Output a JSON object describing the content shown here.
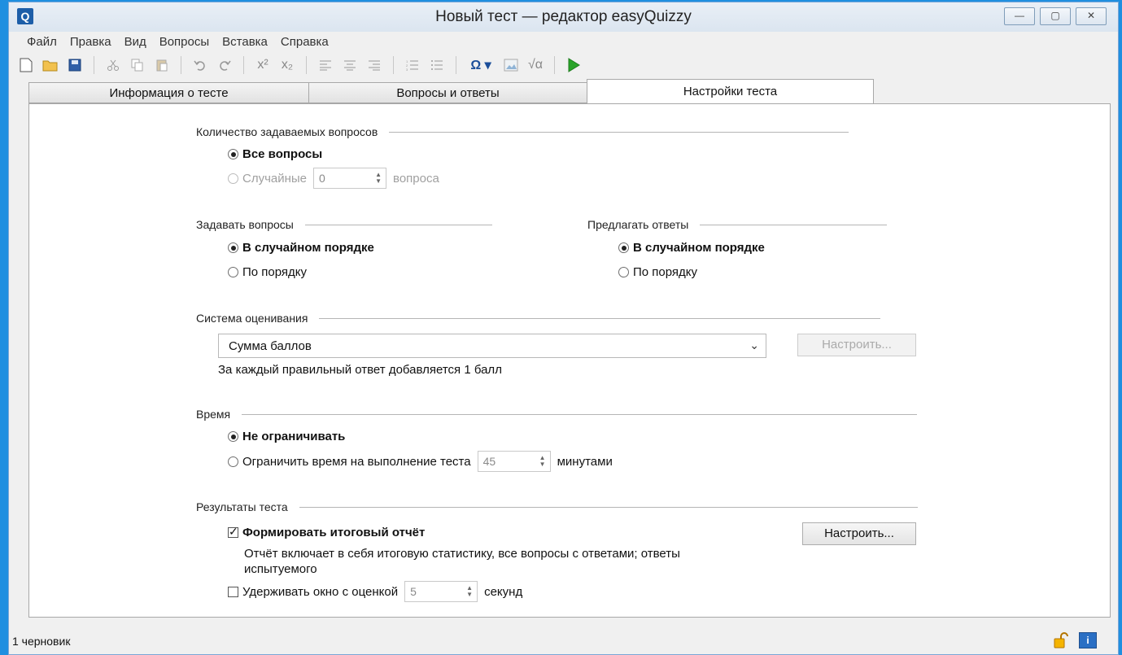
{
  "window": {
    "title": "Новый тест — редактор easyQuizzy",
    "app_icon_letter": "Q",
    "controls": [
      "—",
      "▢",
      "✕"
    ]
  },
  "menu": [
    "Файл",
    "Правка",
    "Вид",
    "Вопросы",
    "Вставка",
    "Справка"
  ],
  "toolbar": {
    "icons": [
      "new-document-icon",
      "open-folder-icon",
      "save-icon",
      "sep",
      "cut-icon",
      "copy-icon",
      "paste-icon",
      "sep",
      "undo-icon",
      "redo-icon",
      "sep",
      "superscript-icon",
      "subscript-icon",
      "sep",
      "align-left-icon",
      "align-center-icon",
      "align-right-icon",
      "sep",
      "numbered-list-icon",
      "bullet-list-icon",
      "sep",
      "symbol-omega-icon",
      "image-icon",
      "formula-icon",
      "sep",
      "run-test-icon"
    ],
    "superscript_label": "x²",
    "subscript_label": "x₂",
    "omega_label": "Ω ▾",
    "formula_label": "√α"
  },
  "tabs": [
    {
      "label": "Информация о тесте",
      "active": false
    },
    {
      "label": "Вопросы и ответы",
      "active": false
    },
    {
      "label": "Настройки теста",
      "active": true
    }
  ],
  "questions_count": {
    "title": "Количество задаваемых вопросов",
    "all_label": "Все вопросы",
    "random_label": "Случайные",
    "random_value": "0",
    "random_unit": "вопроса"
  },
  "ask_questions": {
    "title": "Задавать вопросы",
    "random_label": "В случайном порядке",
    "ordered_label": "По порядку"
  },
  "offer_answers": {
    "title": "Предлагать ответы",
    "random_label": "В случайном порядке",
    "ordered_label": "По порядку"
  },
  "grading": {
    "title": "Система оценивания",
    "selected": "Сумма баллов",
    "configure_label": "Настроить...",
    "description": "За каждый правильный ответ добавляется 1 балл"
  },
  "time": {
    "title": "Время",
    "unlimited_label": "Не ограничивать",
    "limit_label": "Ограничить время на выполнение теста",
    "limit_value": "45",
    "limit_unit": "минутами"
  },
  "results": {
    "title": "Результаты теста",
    "report_label": "Формировать итоговый отчёт",
    "configure_label": "Настроить...",
    "report_description_1": "Отчёт включает в себя итоговую статистику, все вопросы с ответами; ответы",
    "report_description_2": "испытуемого",
    "hold_label": "Удерживать окно с оценкой",
    "hold_value": "5",
    "hold_unit": "секунд"
  },
  "status": {
    "text": "1 черновик",
    "info_letter": "i"
  }
}
